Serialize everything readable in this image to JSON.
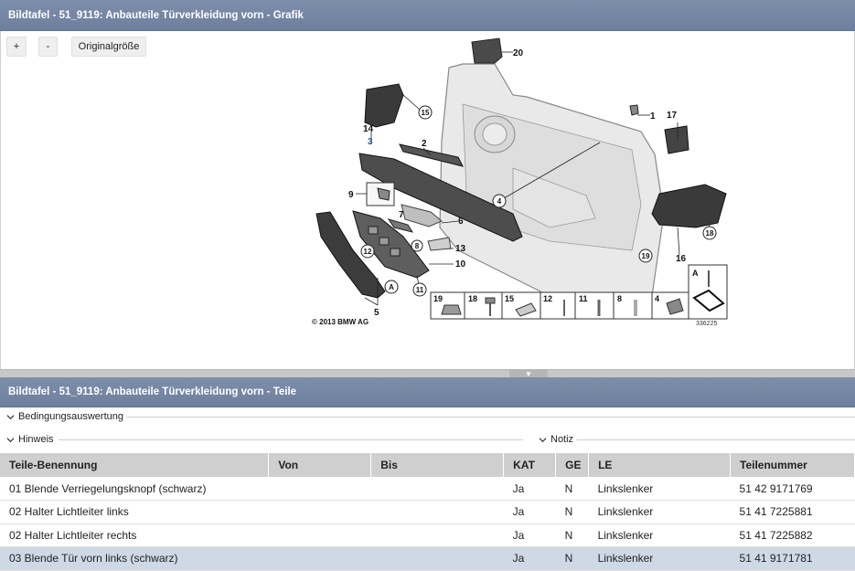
{
  "graphic": {
    "title": "Bildtafel - 51_9119: Anbauteile Türverkleidung vorn - Grafik",
    "zoom_in_label": "+",
    "zoom_out_label": "-",
    "original_size_label": "Originalgröße",
    "copyright": "© 2013 BMW AG",
    "drawing_number": "336225",
    "callouts": [
      "1",
      "2",
      "3",
      "4",
      "5",
      "6",
      "7",
      "8",
      "9",
      "10",
      "11",
      "12",
      "13",
      "14",
      "15",
      "16",
      "17",
      "18",
      "19",
      "20",
      "A"
    ],
    "legend_numbers": [
      "19",
      "18",
      "15",
      "12",
      "11",
      "8",
      "4",
      "A"
    ]
  },
  "parts_panel": {
    "title": "Bildtafel - 51_9119: Anbauteile Türverkleidung vorn - Teile",
    "conditions_label": "Bedingungsauswertung",
    "hint_label": "Hinweis",
    "note_label": "Notiz"
  },
  "table": {
    "columns": [
      "Teile-Benennung",
      "Von",
      "Bis",
      "KAT",
      "GE",
      "LE",
      "Teilenummer"
    ],
    "rows": [
      {
        "name": "01 Blende Verriegelungsknopf (schwarz)",
        "von": "",
        "bis": "",
        "kat": "Ja",
        "ge": "N",
        "le": "Linkslenker",
        "nr": "51 42 9171769"
      },
      {
        "name": "02 Halter Lichtleiter links",
        "von": "",
        "bis": "",
        "kat": "Ja",
        "ge": "N",
        "le": "Linkslenker",
        "nr": "51 41 7225881"
      },
      {
        "name": "02 Halter Lichtleiter rechts",
        "von": "",
        "bis": "",
        "kat": "Ja",
        "ge": "N",
        "le": "Linkslenker",
        "nr": "51 41 7225882"
      },
      {
        "name": "03 Blende Tür vorn links (schwarz)",
        "von": "",
        "bis": "",
        "kat": "Ja",
        "ge": "N",
        "le": "Linkslenker",
        "nr": "51 41 9171781"
      }
    ]
  },
  "colors": {
    "header_bg": "#7486a3",
    "selected_row": "#cfd9e5",
    "table_header_bg": "#cfcfcf"
  }
}
